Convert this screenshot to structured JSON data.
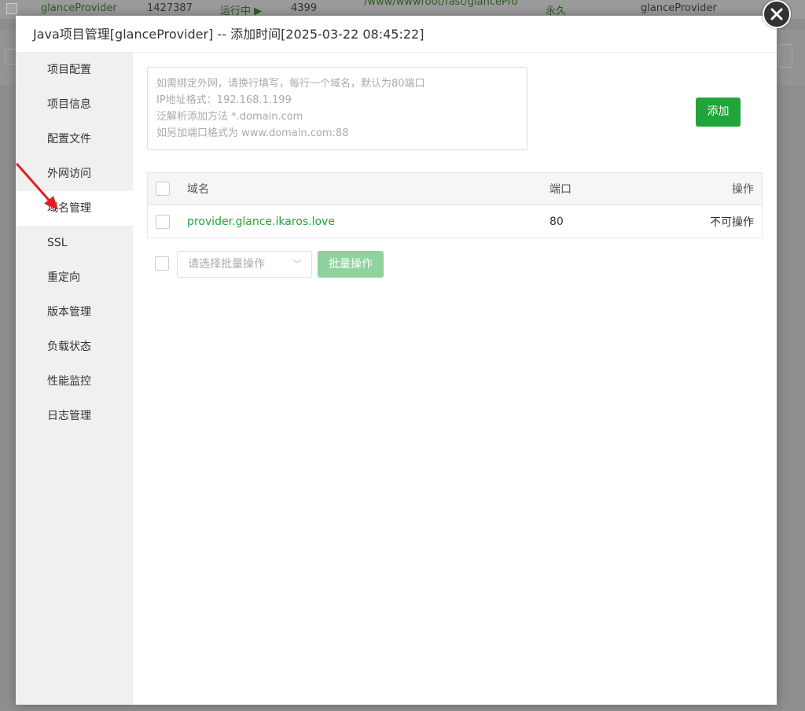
{
  "background": {
    "row": {
      "name": "glanceProvider",
      "pid": "1427387",
      "status": "运行中 ▶",
      "port": "4399",
      "path": "/www/wwwroot/fast/glancePro",
      "expire": "永久",
      "remark": "glanceProvider"
    }
  },
  "dialog": {
    "title": "Java项目管理[glanceProvider] -- 添加时间[2025-03-22 08:45:22]",
    "close_icon": "close-icon"
  },
  "sidebar": {
    "items": [
      {
        "label": "项目配置"
      },
      {
        "label": "项目信息"
      },
      {
        "label": "配置文件"
      },
      {
        "label": "外网访问"
      },
      {
        "label": "域名管理"
      },
      {
        "label": "SSL"
      },
      {
        "label": "重定向"
      },
      {
        "label": "版本管理"
      },
      {
        "label": "负载状态"
      },
      {
        "label": "性能监控"
      },
      {
        "label": "日志管理"
      }
    ],
    "active_index": 4
  },
  "domain_form": {
    "placeholder_lines": [
      "如需绑定外网，请换行填写，每行一个域名，默认为80端口",
      "IP地址格式：192.168.1.199",
      "泛解析添加方法 *.domain.com",
      "如另加端口格式为 www.domain.com:88"
    ],
    "add_label": "添加"
  },
  "table": {
    "headers": {
      "domain": "域名",
      "port": "端口",
      "op": "操作"
    },
    "rows": [
      {
        "domain": "provider.glance.ikaros.love",
        "port": "80",
        "op": "不可操作"
      }
    ]
  },
  "batch": {
    "select_placeholder": "请选择批量操作",
    "button_label": "批量操作"
  },
  "colors": {
    "accent": "#20a53a",
    "annotation_arrow": "#e02020"
  }
}
